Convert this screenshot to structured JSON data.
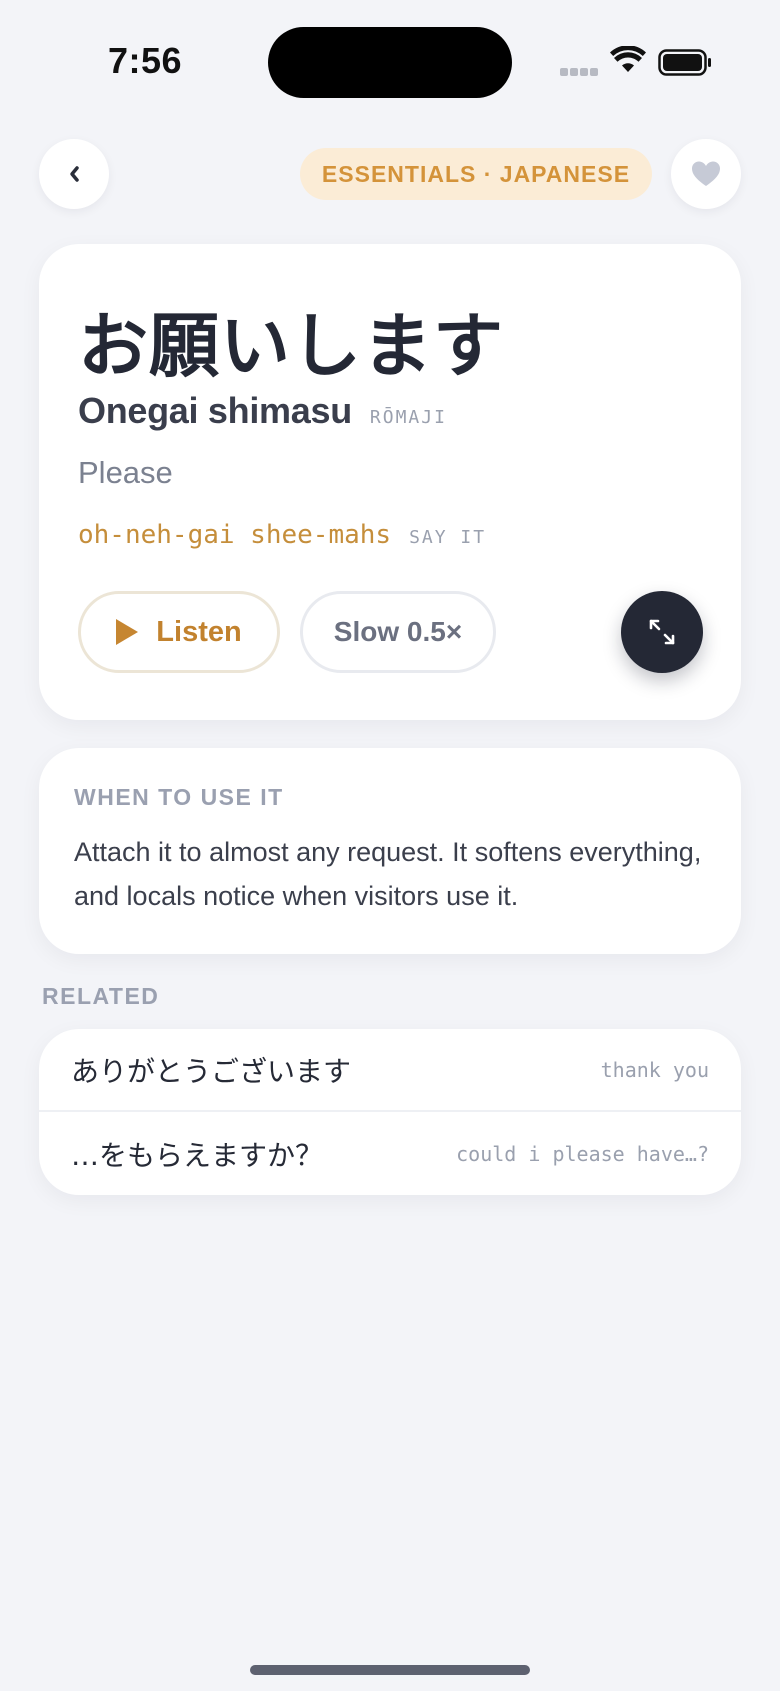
{
  "status_bar": {
    "time": "7:56",
    "icons": [
      "signal-dots-icon",
      "wifi-icon",
      "battery-icon"
    ]
  },
  "nav": {
    "back_icon": "chevron-left-icon",
    "category": "ESSENTIALS · JAPANESE",
    "favorite_icon": "heart-icon"
  },
  "phrase": {
    "native": "お願いします",
    "romaji": "Onegai shimasu",
    "romaji_tag": "RŌMAJI",
    "meaning": "Please",
    "pronunciation": "oh-neh-gai shee-mahs",
    "pronunciation_tag": "SAY IT"
  },
  "actions": {
    "listen_label": "Listen",
    "slow_label": "Slow 0.5×",
    "expand_icon": "expand-icon"
  },
  "usage": {
    "label": "WHEN TO USE IT",
    "text": "Attach it to almost any request. It softens everything, and locals notice when visitors use it."
  },
  "related": {
    "label": "RELATED",
    "items": [
      {
        "native": "ありがとうございます",
        "meaning": "thank you"
      },
      {
        "native": "…をもらえますか？",
        "meaning": "could i please have…?"
      }
    ]
  },
  "colors": {
    "background": "#f3f4f8",
    "accent": "#c58e3b",
    "pill_bg": "#fbecd6",
    "dark": "#242835"
  }
}
